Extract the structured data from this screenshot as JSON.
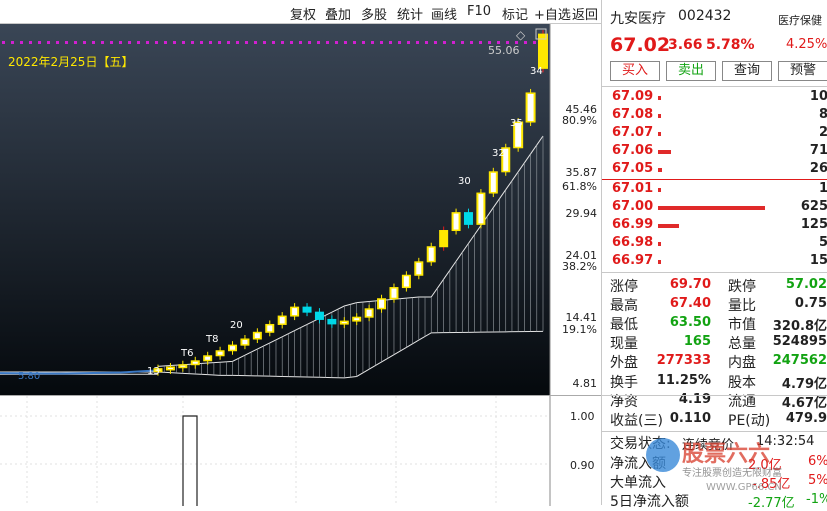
{
  "toolbar": {
    "items": [
      "复权",
      "叠加",
      "多股",
      "统计",
      "画线",
      "F10",
      "标记",
      "+自选",
      "返回"
    ]
  },
  "chart": {
    "date_label": "2022年2月25日【五】",
    "top_value_label": "55.06",
    "axis_prices": [
      "45.46",
      "35.87",
      "29.94",
      "24.01",
      "14.41",
      "4.81"
    ],
    "axis_percents": [
      "80.9%",
      "61.8%",
      "38.2%",
      "19.1%"
    ],
    "candle_labels": [
      "13",
      "T6",
      "T8",
      "20",
      "30",
      "32",
      "34",
      "35"
    ],
    "bottom_left_value": "5.80",
    "lower_axis": [
      "1.00",
      "0.90"
    ]
  },
  "chart_data": {
    "type": "candlestick",
    "y_range": [
      4.81,
      67.4
    ],
    "closes": [
      7.2,
      7.5,
      7.9,
      8.6,
      9.5,
      10.4,
      11.4,
      12.5,
      13.7,
      15.1,
      16.6,
      18.2,
      17.3,
      16.0,
      15.2,
      15.7,
      16.4,
      17.9,
      19.7,
      21.7,
      23.9,
      26.3,
      29.0,
      31.9,
      35.1,
      33.0,
      38.6,
      42.4,
      46.7,
      51.3,
      56.5,
      67.02
    ],
    "opens": [
      6.9,
      7.2,
      7.5,
      7.9,
      8.6,
      9.5,
      10.4,
      11.4,
      12.5,
      13.7,
      15.1,
      16.6,
      18.2,
      17.3,
      16.0,
      15.2,
      15.7,
      16.4,
      17.9,
      19.7,
      21.7,
      23.9,
      26.3,
      29.0,
      31.9,
      35.1,
      33.0,
      38.6,
      42.4,
      46.7,
      51.3,
      60.9
    ]
  },
  "stock": {
    "name": "九安医疗",
    "code": "002432",
    "industry": "医疗保健",
    "industry_pct": "4.25%",
    "price": "67.02",
    "change": "3.66",
    "pct": "5.78%"
  },
  "actions": [
    "买入",
    "卖出",
    "查询",
    "预警"
  ],
  "order_book": {
    "asks": [
      {
        "price": "67.09",
        "vol": "10",
        "bar": 3
      },
      {
        "price": "67.08",
        "vol": "8",
        "bar": 3
      },
      {
        "price": "67.07",
        "vol": "2",
        "bar": 3
      },
      {
        "price": "67.06",
        "vol": "71",
        "bar": 12
      },
      {
        "price": "67.05",
        "vol": "26",
        "bar": 4
      }
    ],
    "bids": [
      {
        "price": "67.01",
        "vol": "1",
        "bar": 3
      },
      {
        "price": "67.00",
        "vol": "625",
        "bar": 100
      },
      {
        "price": "66.99",
        "vol": "125",
        "bar": 20
      },
      {
        "price": "66.98",
        "vol": "5",
        "bar": 3
      },
      {
        "price": "66.97",
        "vol": "15",
        "bar": 3
      }
    ]
  },
  "quotes": {
    "limit_up_label": "涨停",
    "limit_up": "69.70",
    "limit_down_label": "跌停",
    "limit_down": "57.02",
    "high_label": "最高",
    "high": "67.40",
    "vol_ratio_label": "量比",
    "vol_ratio": "0.75",
    "low_label": "最低",
    "low": "63.50",
    "mkt_cap_label": "市值",
    "mkt_cap": "320.8亿",
    "now_label": "现量",
    "now": "165",
    "total_vol_label": "总量",
    "total_vol": "524895",
    "outer_label": "外盘",
    "outer": "277333",
    "inner_label": "内盘",
    "inner": "247562",
    "turnover_label": "换手",
    "turnover": "11.25%",
    "shares_label": "股本",
    "shares": "4.79亿",
    "nav_label": "净资",
    "nav": "4.19",
    "float_label": "流通",
    "float": "4.67亿",
    "eps_label": "收益(三)",
    "eps": "0.110",
    "pe_label": "PE(动)",
    "pe": "479.9",
    "trade_status_label": "交易状态:",
    "trade_status": "连续竞价",
    "time": "14:32:54",
    "net_flow_label": "净流入额",
    "net_flow": "2.0亿",
    "net_flow_pct": "6%",
    "big_flow_label": "大单流入",
    "big_flow": "-.85亿",
    "big_flow_pct": "5%",
    "five_day_label": "5日净流入额",
    "five_day": "-2.77亿",
    "five_day_pct": "-1%"
  },
  "watermark": {
    "title": "股票六六",
    "subtitle": "专注股票创造无限财富",
    "url": "WWW.GP66.CN"
  },
  "colors": {
    "up": "#e01a1a",
    "down": "#12a312",
    "chart_bg_top": "#3a4656",
    "chart_bg_bottom": "#050a0f"
  }
}
